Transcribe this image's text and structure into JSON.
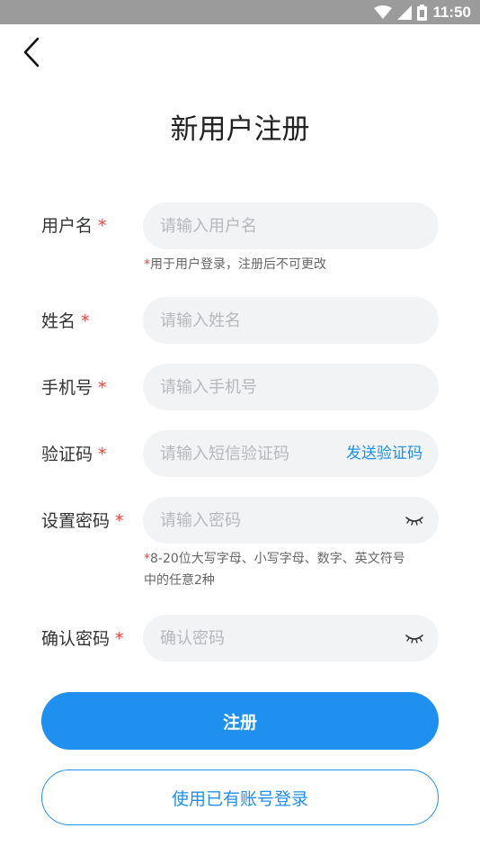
{
  "status_bar": {
    "time": "11:50"
  },
  "header": {
    "title": "新用户注册"
  },
  "required_mark": "*",
  "form": {
    "username": {
      "label": "用户名",
      "placeholder": "请输入用户名",
      "hint": "用于用户登录，注册后不可更改"
    },
    "name": {
      "label": "姓名",
      "placeholder": "请输入姓名"
    },
    "phone": {
      "label": "手机号",
      "placeholder": "请输入手机号"
    },
    "code": {
      "label": "验证码",
      "placeholder": "请输入短信验证码",
      "send_label": "发送验证码"
    },
    "password": {
      "label": "设置密码",
      "placeholder": "请输入密码",
      "hint_line1": "8-20位大写字母、小写字母、数字、英文符号",
      "hint_line2": "中的任意2种"
    },
    "confirm": {
      "label": "确认密码",
      "placeholder": "确认密码"
    }
  },
  "buttons": {
    "register": "注册",
    "login_existing": "使用已有账号登录"
  },
  "colors": {
    "primary": "#1f8ff0",
    "required": "#ff3b30",
    "field_bg": "#f2f3f5",
    "status_bar": "#9b9b9b"
  },
  "icons": {
    "back": "chevron-left-icon",
    "wifi": "wifi-icon",
    "signal": "signal-icon",
    "battery": "battery-icon",
    "eye": "eye-closed-icon"
  }
}
